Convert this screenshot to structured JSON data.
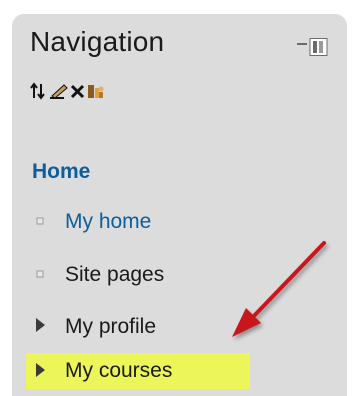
{
  "navigation": {
    "title": "Navigation",
    "icons": [
      "move-icon",
      "edit-icon",
      "delete-icon",
      "hide-icon"
    ],
    "home_label": "Home",
    "items": [
      {
        "label": "My home",
        "style": "link",
        "bullet": "square"
      },
      {
        "label": "Site pages",
        "style": "text",
        "bullet": "square"
      },
      {
        "label": "My profile",
        "style": "text",
        "bullet": "triangle"
      },
      {
        "label": "My courses",
        "style": "text",
        "bullet": "triangle",
        "highlighted": true
      }
    ]
  },
  "colors": {
    "panel_bg": "#dcdcdc",
    "link": "#0e5d9c",
    "highlight": "#ecf55a",
    "arrow": "#c8151b"
  }
}
